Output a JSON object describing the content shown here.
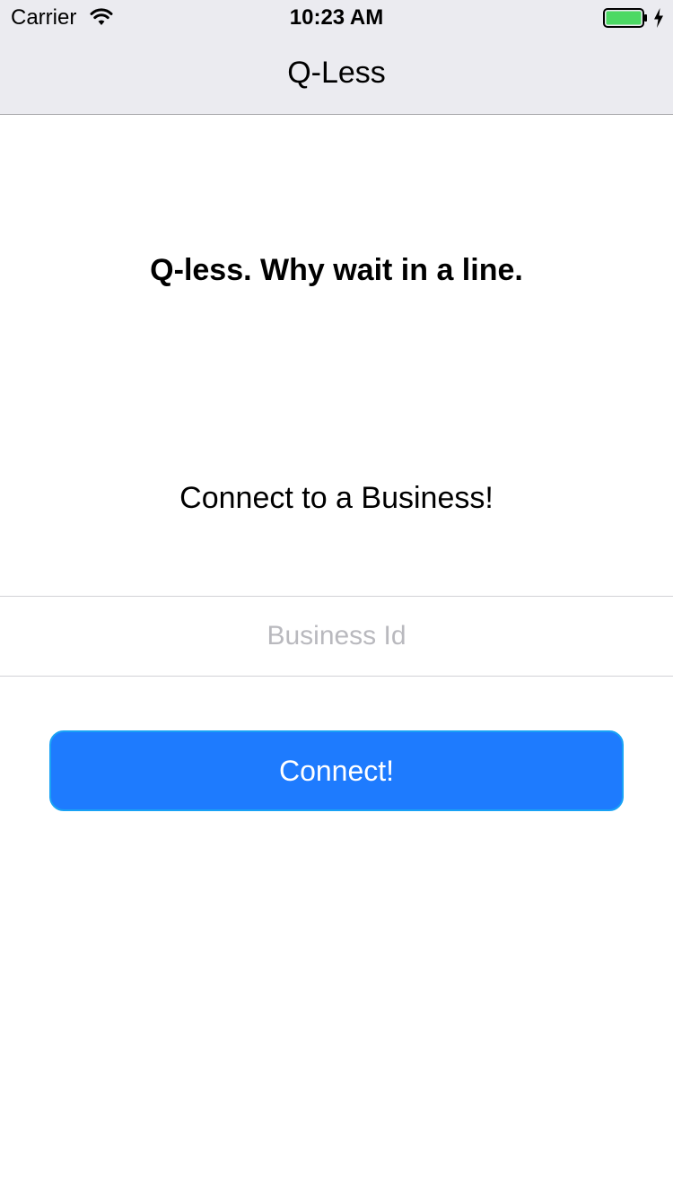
{
  "status_bar": {
    "carrier": "Carrier",
    "time": "10:23 AM",
    "battery_level": 1.0,
    "battery_color": "#4cd964",
    "charging": true
  },
  "nav": {
    "title": "Q-Less"
  },
  "main": {
    "tagline": "Q-less. Why wait in a line.",
    "connect_heading": "Connect to a Business!",
    "business_id_placeholder": "Business Id",
    "business_id_value": "",
    "connect_label": "Connect!"
  },
  "colors": {
    "accent": "#1e7bfe",
    "nav_background": "#ebebf0"
  }
}
